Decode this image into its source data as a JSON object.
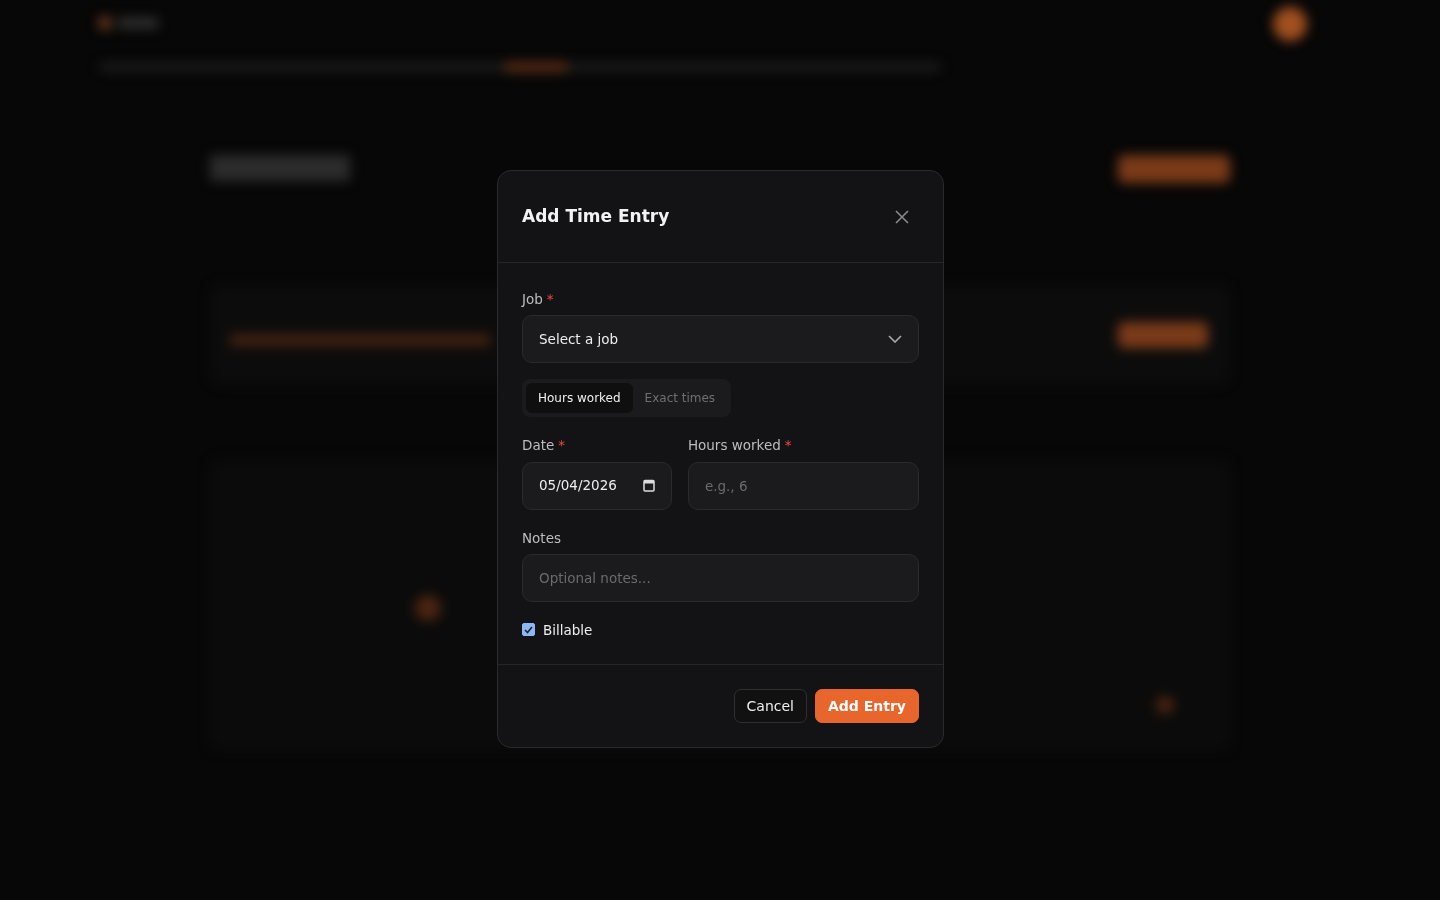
{
  "dialog": {
    "title": "Add Time Entry",
    "job": {
      "label": "Job",
      "required_mark": "*",
      "value": "Select a job"
    },
    "modes": [
      {
        "label": "Hours worked",
        "selected": true
      },
      {
        "label": "Exact times",
        "selected": false
      }
    ],
    "date": {
      "label": "Date",
      "required_mark": "*",
      "value": "05/04/2026"
    },
    "hours": {
      "label": "Hours worked",
      "required_mark": "*",
      "placeholder": "e.g., 6"
    },
    "notes": {
      "label": "Notes",
      "placeholder": "Optional notes..."
    },
    "billable": {
      "label": "Billable",
      "checked": true
    },
    "buttons": [
      {
        "label": "Cancel",
        "kind": "secondary"
      },
      {
        "label": "Add Entry",
        "kind": "primary"
      }
    ]
  }
}
